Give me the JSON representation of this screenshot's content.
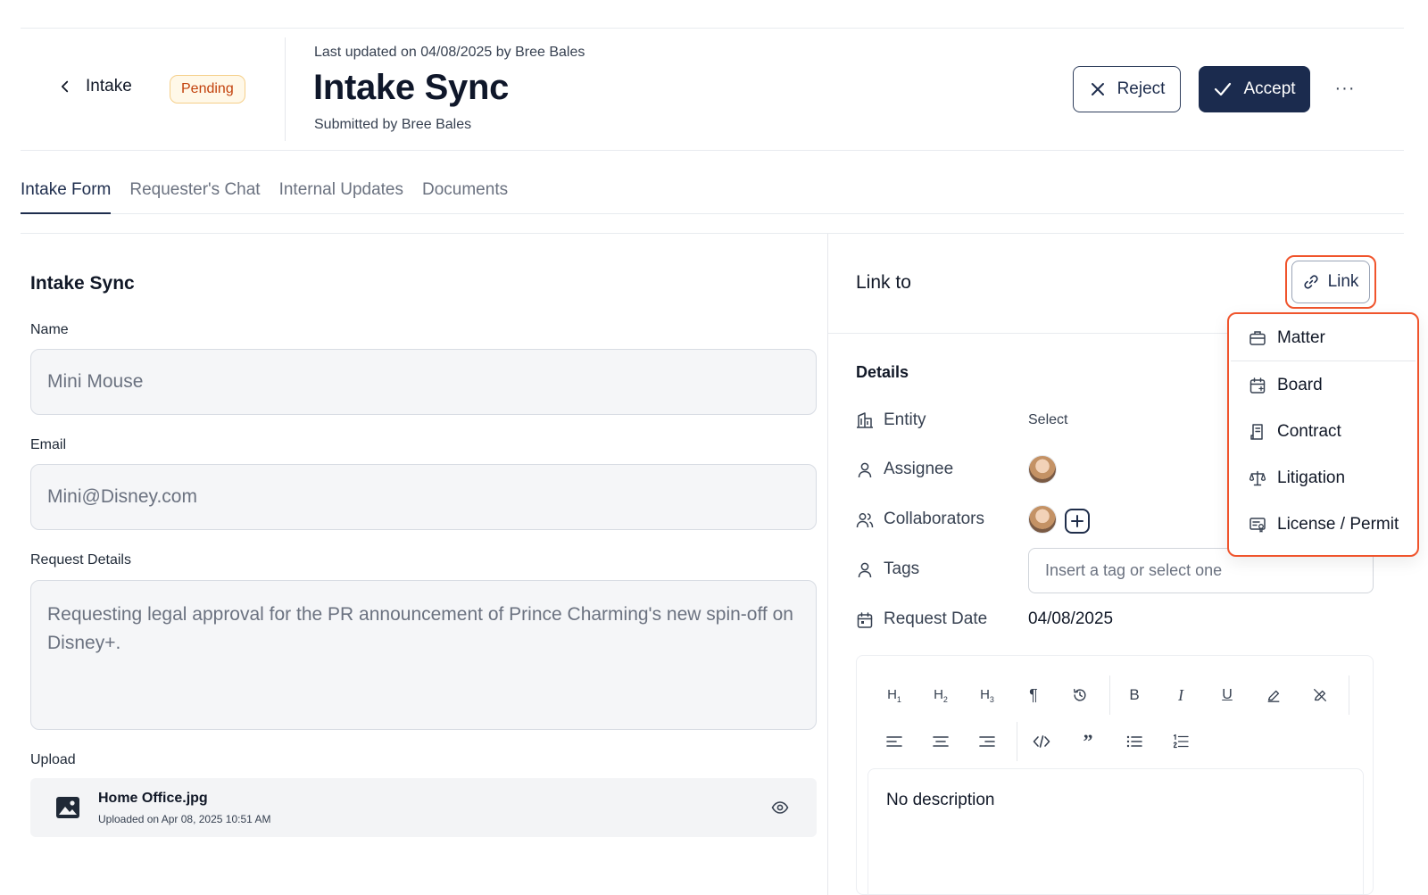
{
  "header": {
    "back_label": "Intake",
    "status_badge": "Pending",
    "last_updated": "Last updated on 04/08/2025 by Bree Bales",
    "title": "Intake Sync",
    "submitted_by": "Submitted by Bree Bales",
    "reject_label": "Reject",
    "accept_label": "Accept",
    "more_label": "···"
  },
  "tabs": [
    {
      "label": "Intake Form",
      "active": true
    },
    {
      "label": "Requester's Chat",
      "active": false
    },
    {
      "label": "Internal Updates",
      "active": false
    },
    {
      "label": "Documents",
      "active": false
    }
  ],
  "form": {
    "section_title": "Intake Sync",
    "name_label": "Name",
    "name_value": "Mini Mouse",
    "email_label": "Email",
    "email_value": "Mini@Disney.com",
    "details_label": "Request Details",
    "details_value": "Requesting legal approval for the PR announcement of Prince Charming's new spin-off on Disney+.",
    "upload_label": "Upload",
    "upload_file_name": "Home Office.jpg",
    "upload_date": "Uploaded on Apr 08, 2025 10:51 AM"
  },
  "right_panel": {
    "link_to_label": "Link to",
    "link_button_label": "Link",
    "details_title": "Details",
    "entity_label": "Entity",
    "entity_value": "Select",
    "assignee_label": "Assignee",
    "collaborators_label": "Collaborators",
    "tags_label": "Tags",
    "tags_placeholder": "Insert a tag or select one",
    "request_date_label": "Request Date",
    "request_date_value": "04/08/2025",
    "description": "No description"
  },
  "link_menu": [
    {
      "label": "Matter",
      "icon": "briefcase-icon"
    },
    {
      "label": "Board",
      "icon": "calendar-board-icon"
    },
    {
      "label": "Contract",
      "icon": "contract-icon"
    },
    {
      "label": "Litigation",
      "icon": "scales-icon"
    },
    {
      "label": "License / Permit",
      "icon": "license-icon"
    }
  ],
  "colors": {
    "accent": "#1b2b4e",
    "highlight": "#f0542c",
    "badge_text": "#c2410c",
    "badge_bg": "#fff8e8"
  }
}
